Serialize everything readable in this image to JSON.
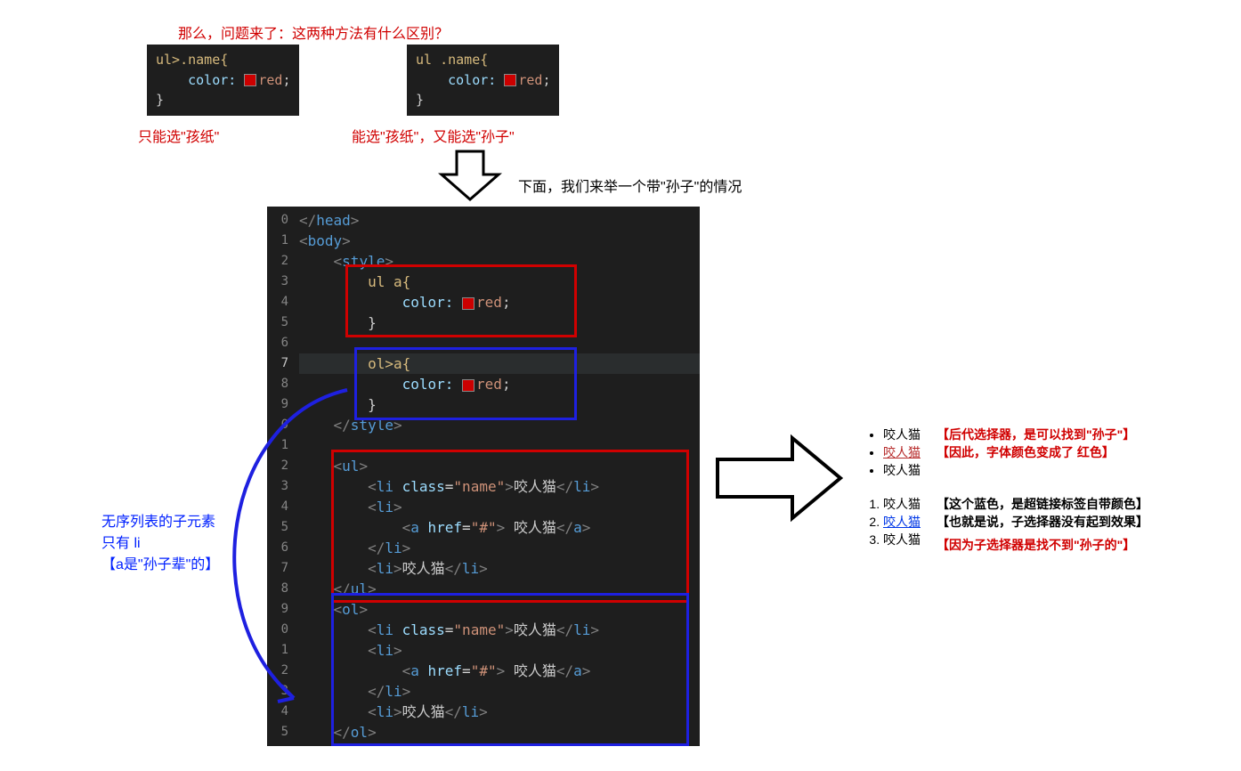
{
  "question": "那么，问题来了：这两种方法有什么区别？",
  "snippet1": {
    "line1": "ul>.name{",
    "prop": "color:",
    "val": "red",
    "close": "}",
    "caption": "只能选\"孩纸\""
  },
  "snippet2": {
    "line1": "ul .name{",
    "prop": "color:",
    "val": "red",
    "close": "}",
    "caption": "能选\"孩纸\"，又能选\"孙子\""
  },
  "arrow_down_label": "下面，我们来举一个带\"孙子\"的情况",
  "editor": {
    "line_numbers": [
      "0",
      "1",
      "2",
      "3",
      "4",
      "5",
      "6",
      "7",
      "8",
      "9",
      "0",
      "1",
      "2",
      "3",
      "4",
      "5",
      "6",
      "7",
      "8",
      "9",
      "0",
      "1",
      "2",
      "3",
      "4",
      "5"
    ],
    "head_close": "</head>",
    "body_open": "<body>",
    "style_open": "<style>",
    "rule1_sel": "ul a{",
    "rule_prop": "color:",
    "rule_val": "red",
    "rule_close": "}",
    "rule2_sel": "ol>a{",
    "style_close": "</style>",
    "ul_open": "<ul>",
    "li_name_open": "<li class=\"name\">",
    "li_name_text": "咬人猫",
    "li_open": "<li>",
    "a_open": "<a href=\"#\"> ",
    "a_text": "咬人猫",
    "a_close": "</a>",
    "li_close": "</li>",
    "li_plain_text": "咬人猫",
    "ul_close": "</ul>",
    "ol_open": "<ol>",
    "ol_close": "</ol>"
  },
  "output": {
    "ul_items": [
      "咬人猫",
      "咬人猫",
      "咬人猫"
    ],
    "ol_items": [
      "咬人猫",
      "咬人猫",
      "咬人猫"
    ],
    "note1a": "【后代选择器，是可以找到\"孙子\"】",
    "note1b": "【因此，字体颜色变成了 红色】",
    "note2a": "【这个蓝色，是超链接标签自带颜色】",
    "note2b": "【也就是说，子选择器没有起到效果】",
    "note2c": "【因为子选择器是找不到\"孙子的\"】"
  },
  "left_note": {
    "l1": "无序列表的子元素",
    "l2": "只有 li",
    "l3": "【a是\"孙子辈\"的】"
  }
}
